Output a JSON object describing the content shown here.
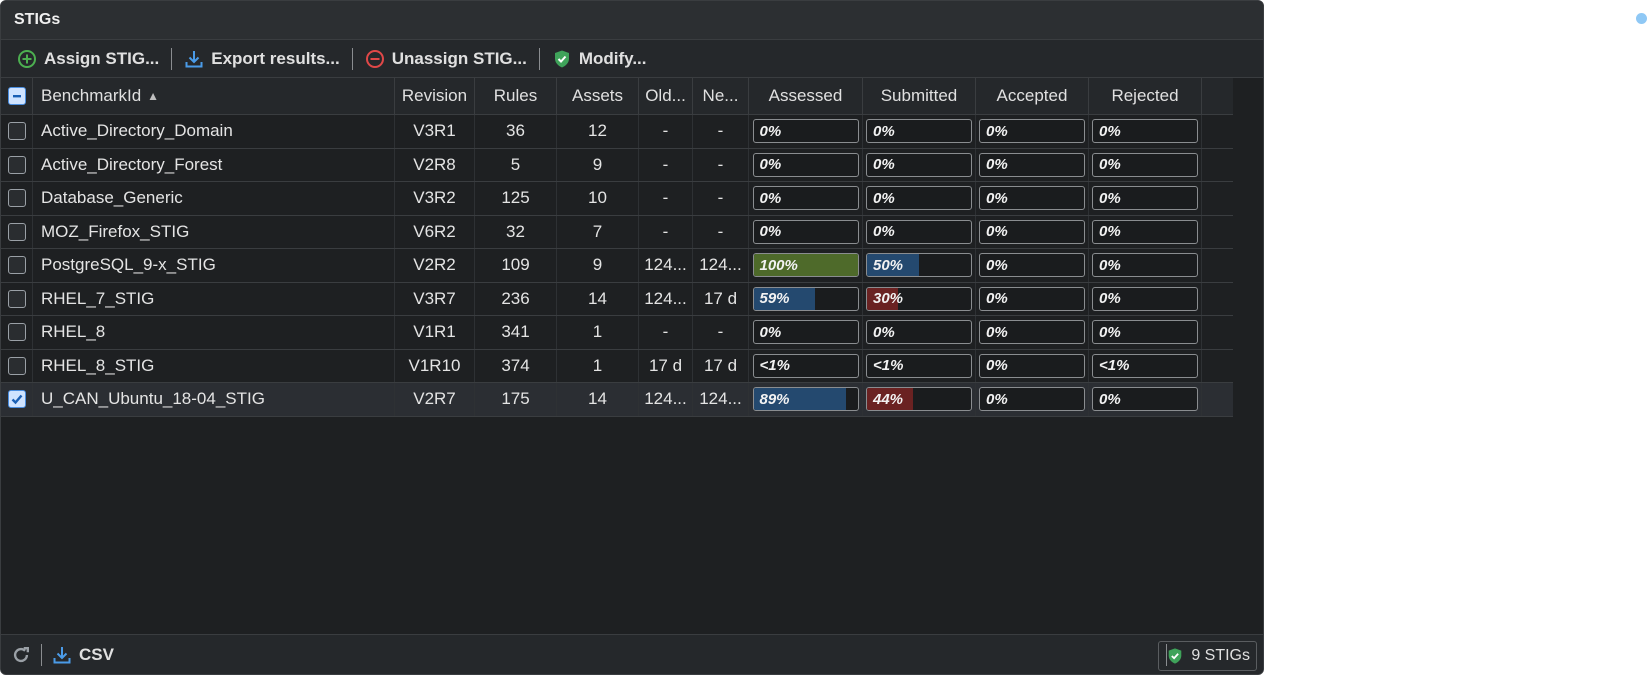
{
  "panel": {
    "title": "STIGs"
  },
  "toolbar": {
    "assign": "Assign STIG...",
    "export": "Export results...",
    "unassign": "Unassign STIG...",
    "modify": "Modify..."
  },
  "columns": [
    "BenchmarkId",
    "Revision",
    "Rules",
    "Assets",
    "Old...",
    "Ne...",
    "Assessed",
    "Submitted",
    "Accepted",
    "Rejected"
  ],
  "rows": [
    {
      "benchmark": "Active_Directory_Domain",
      "revision": "V3R1",
      "rules": "36",
      "assets": "12",
      "oldest": "-",
      "newest": "-",
      "assessed": "0%",
      "submitted": "0%",
      "accepted": "0%",
      "rejected": "0%",
      "assessed_pct": 0,
      "submitted_pct": 0,
      "checked": false
    },
    {
      "benchmark": "Active_Directory_Forest",
      "revision": "V2R8",
      "rules": "5",
      "assets": "9",
      "oldest": "-",
      "newest": "-",
      "assessed": "0%",
      "submitted": "0%",
      "accepted": "0%",
      "rejected": "0%",
      "assessed_pct": 0,
      "submitted_pct": 0,
      "checked": false
    },
    {
      "benchmark": "Database_Generic",
      "revision": "V3R2",
      "rules": "125",
      "assets": "10",
      "oldest": "-",
      "newest": "-",
      "assessed": "0%",
      "submitted": "0%",
      "accepted": "0%",
      "rejected": "0%",
      "assessed_pct": 0,
      "submitted_pct": 0,
      "checked": false
    },
    {
      "benchmark": "MOZ_Firefox_STIG",
      "revision": "V6R2",
      "rules": "32",
      "assets": "7",
      "oldest": "-",
      "newest": "-",
      "assessed": "0%",
      "submitted": "0%",
      "accepted": "0%",
      "rejected": "0%",
      "assessed_pct": 0,
      "submitted_pct": 0,
      "checked": false
    },
    {
      "benchmark": "PostgreSQL_9-x_STIG",
      "revision": "V2R2",
      "rules": "109",
      "assets": "9",
      "oldest": "124...",
      "newest": "124...",
      "assessed": "100%",
      "submitted": "50%",
      "accepted": "0%",
      "rejected": "0%",
      "assessed_pct": 100,
      "submitted_pct": 50,
      "checked": false
    },
    {
      "benchmark": "RHEL_7_STIG",
      "revision": "V3R7",
      "rules": "236",
      "assets": "14",
      "oldest": "124...",
      "newest": "17 d",
      "assessed": "59%",
      "submitted": "30%",
      "accepted": "0%",
      "rejected": "0%",
      "assessed_pct": 59,
      "submitted_pct": 30,
      "checked": false
    },
    {
      "benchmark": "RHEL_8",
      "revision": "V1R1",
      "rules": "341",
      "assets": "1",
      "oldest": "-",
      "newest": "-",
      "assessed": "0%",
      "submitted": "0%",
      "accepted": "0%",
      "rejected": "0%",
      "assessed_pct": 0,
      "submitted_pct": 0,
      "checked": false
    },
    {
      "benchmark": "RHEL_8_STIG",
      "revision": "V1R10",
      "rules": "374",
      "assets": "1",
      "oldest": "17 d",
      "newest": "17 d",
      "assessed": "<1%",
      "submitted": "<1%",
      "accepted": "0%",
      "rejected": "<1%",
      "assessed_pct": 0,
      "submitted_pct": 0,
      "checked": false
    },
    {
      "benchmark": "U_CAN_Ubuntu_18-04_STIG",
      "revision": "V2R7",
      "rules": "175",
      "assets": "14",
      "oldest": "124...",
      "newest": "124...",
      "assessed": "89%",
      "submitted": "44%",
      "accepted": "0%",
      "rejected": "0%",
      "assessed_pct": 89,
      "submitted_pct": 44,
      "checked": true
    }
  ],
  "statusbar": {
    "csv": "CSV",
    "count": "9 STIGs"
  },
  "colors": {
    "assessed_full": "#4e6a2a",
    "assessed_partial": "#24496f",
    "submitted": "#24496f",
    "submitted_low": "#6a2222"
  },
  "icons": [
    "plus-circle-icon",
    "download-icon",
    "minus-circle-icon",
    "shield-check-icon",
    "refresh-icon",
    "sort-asc-icon"
  ]
}
